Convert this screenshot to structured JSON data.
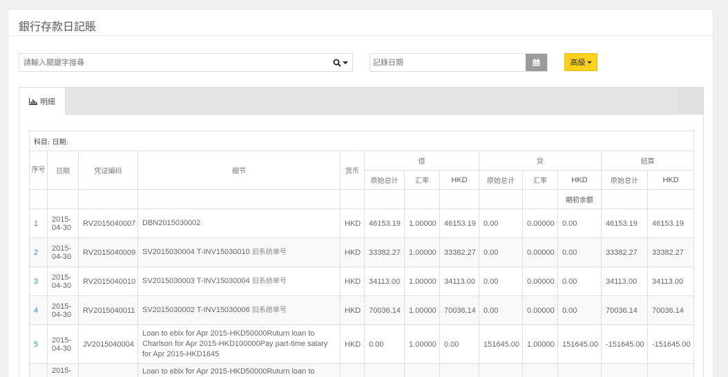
{
  "page": {
    "title": "銀行存款日記賬"
  },
  "search": {
    "placeholder": "請輸入關鍵字搜尋"
  },
  "date": {
    "placeholder": "記錄日期"
  },
  "advanced_label": "高級",
  "tabs": [
    {
      "label": "明細"
    }
  ],
  "table": {
    "info": "科目:  日期:",
    "headers": {
      "seq": "序号",
      "date": "日期",
      "voucher": "凭证编码",
      "detail": "细节",
      "currency": "货币",
      "debit": "借",
      "credit": "贷",
      "settle": "结算",
      "orig_total": "原始总计",
      "rate": "汇率",
      "hkd": "HKD"
    },
    "opening_balance": "期初余额",
    "rows": [
      {
        "seq": "1",
        "date": "2015-04-30",
        "voucher": "RV2015040007",
        "detail": "DBN2015030002",
        "detail_zh": "",
        "currency": "HKD",
        "d_orig": "46153.19",
        "d_rate": "1.00000",
        "d_hkd": "46153.19",
        "c_orig": "0.00",
        "c_rate": "0.00000",
        "c_hkd": "0.00",
        "s_orig": "46153.19",
        "s_hkd": "46153.19"
      },
      {
        "seq": "2",
        "date": "2015-04-30",
        "voucher": "RV2015040009",
        "detail": "SV2015030004 T-INV15030010",
        "detail_zh": "旧系统单号",
        "currency": "HKD",
        "d_orig": "33382.27",
        "d_rate": "1.00000",
        "d_hkd": "33382.27",
        "c_orig": "0.00",
        "c_rate": "0.00000",
        "c_hkd": "0.00",
        "s_orig": "33382.27",
        "s_hkd": "33382.27"
      },
      {
        "seq": "3",
        "date": "2015-04-30",
        "voucher": "RV2015040010",
        "detail": "SV2015030003 T-INV15030004",
        "detail_zh": "旧系统单号",
        "currency": "HKD",
        "d_orig": "34113.00",
        "d_rate": "1.00000",
        "d_hkd": "34113.00",
        "c_orig": "0.00",
        "c_rate": "0.00000",
        "c_hkd": "0.00",
        "s_orig": "34113.00",
        "s_hkd": "34113.00"
      },
      {
        "seq": "4",
        "date": "2015-04-30",
        "voucher": "RV2015040011",
        "detail": "SV2015030002 T-INV15030006",
        "detail_zh": "旧系统单号",
        "currency": "HKD",
        "d_orig": "70036.14",
        "d_rate": "1.00000",
        "d_hkd": "70036.14",
        "c_orig": "0.00",
        "c_rate": "0.00000",
        "c_hkd": "0.00",
        "s_orig": "70036.14",
        "s_hkd": "70036.14"
      },
      {
        "seq": "5",
        "date": "2015-04-30",
        "voucher": "JV2015040004",
        "detail": "Loan to ebix for Apr 2015-HKD50000Ruturn loan to Charlson for Apr 2015-HKD100000Pay part-time salary for Apr 2015-HKD1645",
        "detail_zh": "",
        "currency": "HKD",
        "d_orig": "0.00",
        "d_rate": "1.00000",
        "d_hkd": "0.00",
        "c_orig": "151645.00",
        "c_rate": "1.00000",
        "c_hkd": "151645.00",
        "s_orig": "-151645.00",
        "s_hkd": "-151645.00"
      },
      {
        "seq": "",
        "date": "2015-",
        "voucher": "",
        "detail": "Loan to ebix for Apr 2015-HKD50000Ruturn loan to",
        "detail_zh": "",
        "currency": "",
        "d_orig": "",
        "d_rate": "",
        "d_hkd": "",
        "c_orig": "",
        "c_rate": "",
        "c_hkd": "",
        "s_orig": "",
        "s_hkd": ""
      }
    ]
  },
  "icons": {
    "search": "search-icon",
    "calendar": "calendar-icon",
    "chart": "bar-chart-icon"
  }
}
